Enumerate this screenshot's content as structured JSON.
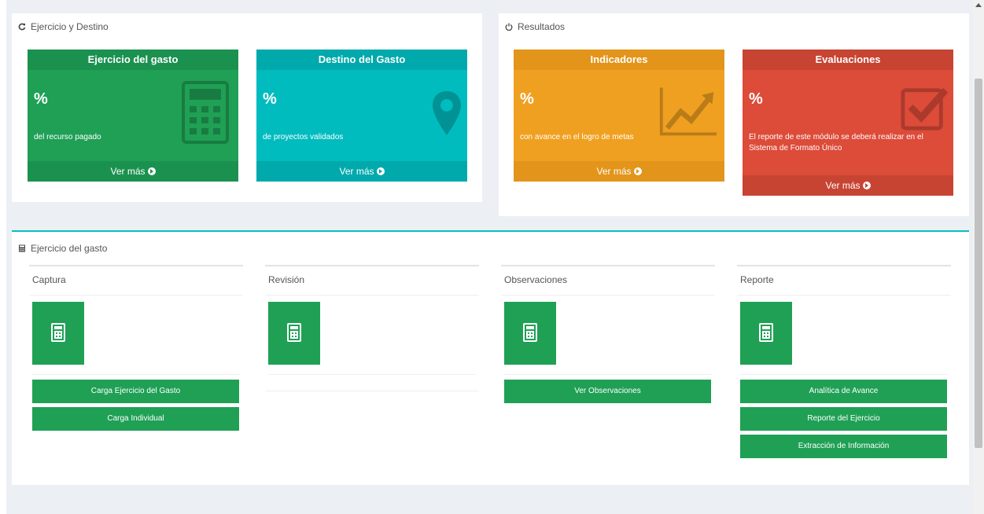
{
  "colors": {
    "green": "#1fa055",
    "teal": "#00bcbf",
    "orange": "#f0a020",
    "red": "#dd4b39",
    "accent_line": "#00c0c0"
  },
  "panel_destino": {
    "title": "Ejercicio y Destino",
    "cards": [
      {
        "title": "Ejercicio del gasto",
        "pct": "%",
        "text": "del recurso pagado",
        "link": "Ver más",
        "icon": "calculator-icon"
      },
      {
        "title": "Destino del Gasto",
        "pct": "%",
        "text": "de proyectos validados",
        "link": "Ver más",
        "icon": "map-marker-icon"
      }
    ]
  },
  "panel_resultados": {
    "title": "Resultados",
    "cards": [
      {
        "title": "Indicadores",
        "pct": "%",
        "text": "con avance en el logro de metas",
        "link": "Ver más",
        "icon": "line-chart-icon"
      },
      {
        "title": "Evaluaciones",
        "pct": "%",
        "text": "El reporte de este módulo se deberá realizar en el Sistema de Formato Único",
        "link": "Ver más",
        "icon": "check-square-icon"
      }
    ]
  },
  "panel_gasto": {
    "title": "Ejercicio del gasto",
    "columns": [
      {
        "title": "Captura",
        "buttons": [
          "Carga Ejercicio del Gasto",
          "Carga Individual"
        ]
      },
      {
        "title": "Revisión",
        "buttons": []
      },
      {
        "title": "Observaciones",
        "buttons": [
          "Ver Observaciones"
        ]
      },
      {
        "title": "Reporte",
        "buttons": [
          "Analítica de Avance",
          "Reporte del Ejercicio",
          "Extracción de Información"
        ]
      }
    ]
  }
}
